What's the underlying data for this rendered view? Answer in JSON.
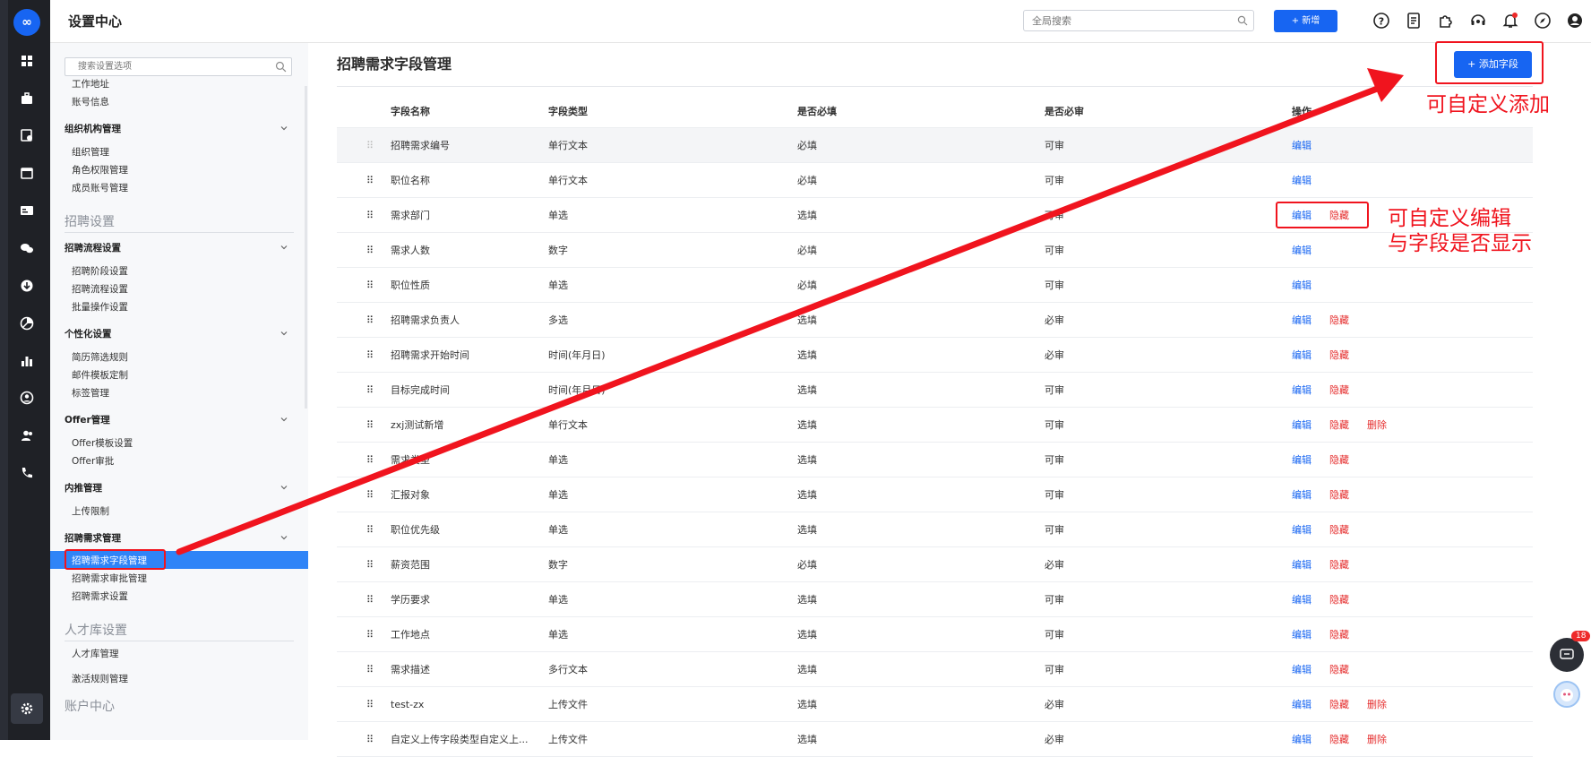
{
  "header": {
    "title": "设置中心",
    "search_placeholder": "全局搜索",
    "new_label": "+ 新增"
  },
  "sidebar": {
    "search_placeholder": "搜索设置选项",
    "top_items": [
      "工作地址",
      "账号信息"
    ],
    "group_org": {
      "label": "组织机构管理",
      "items": [
        "组织管理",
        "角色权限管理",
        "成员账号管理"
      ]
    },
    "section_recruit": "招聘设置",
    "group_flow": {
      "label": "招聘流程设置",
      "items": [
        "招聘阶段设置",
        "招聘流程设置",
        "批量操作设置"
      ]
    },
    "group_personal": {
      "label": "个性化设置",
      "items": [
        "简历筛选规则",
        "邮件模板定制",
        "标签管理"
      ]
    },
    "group_offer": {
      "label": "Offer管理",
      "items": [
        "Offer模板设置",
        "Offer审批"
      ]
    },
    "group_referral": {
      "label": "内推管理",
      "items": [
        "上传限制"
      ]
    },
    "group_demand": {
      "label": "招聘需求管理",
      "items": [
        "招聘需求字段管理",
        "招聘需求审批管理",
        "招聘需求设置"
      ]
    },
    "section_talent": "人才库设置",
    "talent_items": [
      "人才库管理",
      "激活规则管理"
    ],
    "section_account": "账户中心"
  },
  "main": {
    "title": "招聘需求字段管理",
    "add_button": "+ 添加字段",
    "columns": [
      "字段名称",
      "字段类型",
      "是否必填",
      "是否必审",
      "操作"
    ],
    "action_labels": {
      "edit": "编辑",
      "hide": "隐藏",
      "delete": "删除"
    },
    "rows": [
      [
        "招聘需求编号",
        "单行文本",
        "必填",
        "可审"
      ],
      [
        "职位名称",
        "单行文本",
        "必填",
        "可审"
      ],
      [
        "需求部门",
        "单选",
        "选填",
        "可审"
      ],
      [
        "需求人数",
        "数字",
        "必填",
        "可审"
      ],
      [
        "职位性质",
        "单选",
        "必填",
        "可审"
      ],
      [
        "招聘需求负责人",
        "多选",
        "选填",
        "必审"
      ],
      [
        "招聘需求开始时间",
        "时间(年月日)",
        "选填",
        "必审"
      ],
      [
        "目标完成时间",
        "时间(年月日)",
        "选填",
        "可审"
      ],
      [
        "zxj测试新增",
        "单行文本",
        "选填",
        "可审"
      ],
      [
        "需求类型",
        "单选",
        "选填",
        "可审"
      ],
      [
        "汇报对象",
        "单选",
        "选填",
        "可审"
      ],
      [
        "职位优先级",
        "单选",
        "选填",
        "可审"
      ],
      [
        "薪资范围",
        "数字",
        "必填",
        "必审"
      ],
      [
        "学历要求",
        "单选",
        "选填",
        "可审"
      ],
      [
        "工作地点",
        "单选",
        "选填",
        "可审"
      ],
      [
        "需求描述",
        "多行文本",
        "选填",
        "可审"
      ],
      [
        "test-zx",
        "上传文件",
        "选填",
        "必审"
      ],
      [
        "自定义上传字段类型自定义上...",
        "上传文件",
        "选填",
        "必审"
      ]
    ],
    "row_actions": [
      [
        "edit"
      ],
      [
        "edit"
      ],
      [
        "edit",
        "hide"
      ],
      [
        "edit"
      ],
      [
        "edit"
      ],
      [
        "edit",
        "hide"
      ],
      [
        "edit",
        "hide"
      ],
      [
        "edit",
        "hide"
      ],
      [
        "edit",
        "hide",
        "delete"
      ],
      [
        "edit",
        "hide"
      ],
      [
        "edit",
        "hide"
      ],
      [
        "edit",
        "hide"
      ],
      [
        "edit",
        "hide"
      ],
      [
        "edit",
        "hide"
      ],
      [
        "edit",
        "hide"
      ],
      [
        "edit",
        "hide"
      ],
      [
        "edit",
        "hide",
        "delete"
      ],
      [
        "edit",
        "hide",
        "delete"
      ]
    ]
  },
  "annotations": {
    "add_note": "可自定义添加",
    "edit_note_line1": "可自定义编辑",
    "edit_note_line2": "与字段是否显示"
  },
  "chat_badge": "18",
  "colors": {
    "primary": "#1765f2",
    "danger": "#e52d2d",
    "annotation": "#f0141e",
    "rail": "#1f2126",
    "sidebar_active": "#2f84f7"
  }
}
